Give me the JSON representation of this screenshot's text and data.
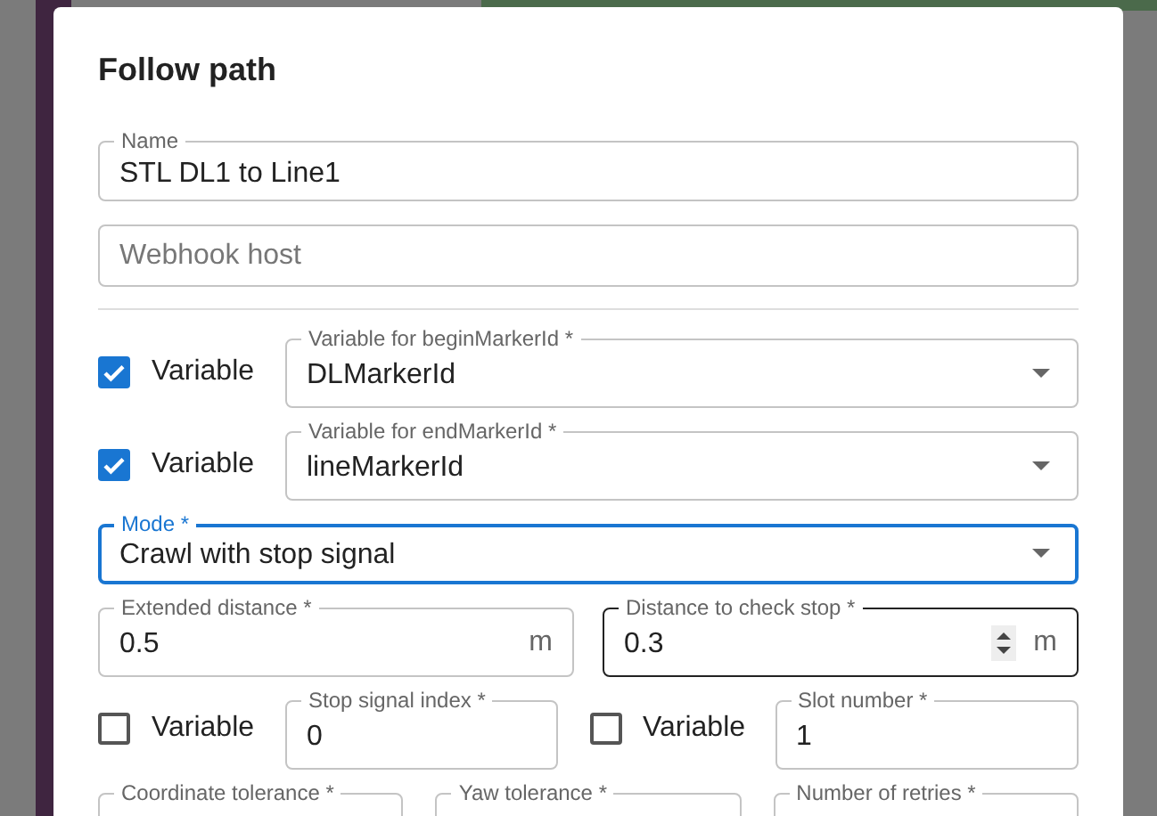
{
  "dialog": {
    "title": "Follow path",
    "name_field": {
      "label": "Name",
      "value": "STL DL1 to Line1"
    },
    "webhook_field": {
      "placeholder": "Webhook host"
    },
    "variable_rows": [
      {
        "checkbox_label": "Variable",
        "checked": true,
        "field_label": "Variable for beginMarkerId *",
        "value": "DLMarkerId"
      },
      {
        "checkbox_label": "Variable",
        "checked": true,
        "field_label": "Variable for endMarkerId *",
        "value": "lineMarkerId"
      }
    ],
    "mode_field": {
      "label": "Mode *",
      "value": "Crawl with stop signal",
      "focused": true
    },
    "distance_fields": [
      {
        "label": "Extended distance *",
        "value": "0.5",
        "unit": "m",
        "hovered": false
      },
      {
        "label": "Distance to check stop *",
        "value": "0.3",
        "unit": "m",
        "hovered": true
      }
    ],
    "signal_fields": [
      {
        "checkbox_label": "Variable",
        "checked": false,
        "field_label": "Stop signal index *",
        "value": "0"
      },
      {
        "checkbox_label": "Variable",
        "checked": false,
        "field_label": "Slot number *",
        "value": "1"
      }
    ],
    "tolerance_fields": [
      {
        "label": "Coordinate tolerance *"
      },
      {
        "label": "Yaw tolerance *"
      },
      {
        "label": "Number of retries *"
      }
    ]
  }
}
